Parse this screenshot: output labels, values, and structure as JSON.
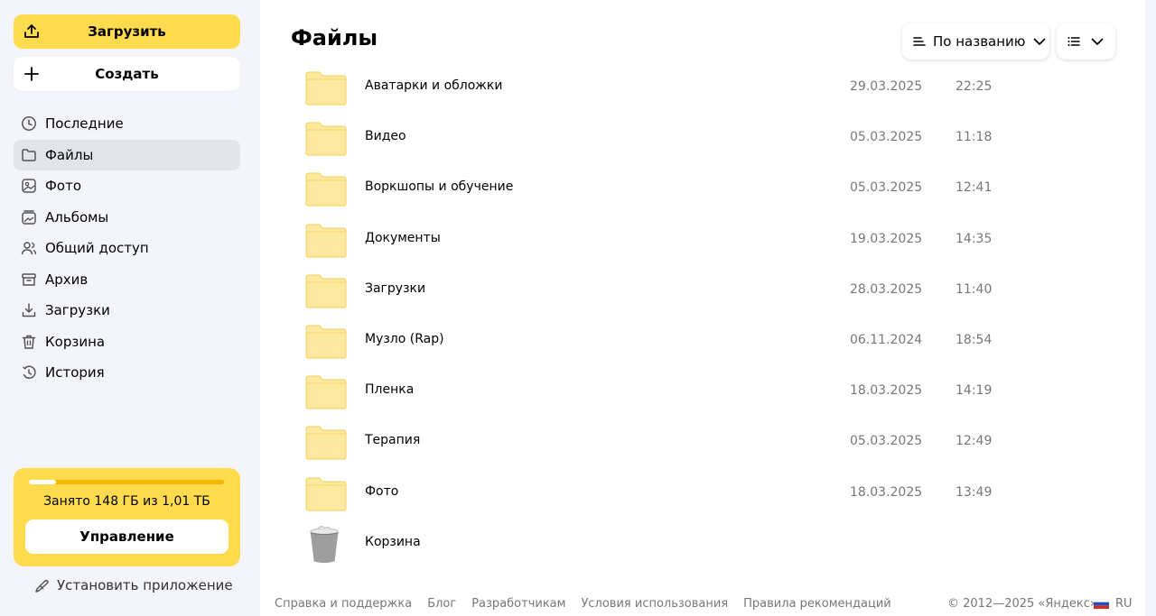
{
  "sidebar": {
    "upload_label": "Загрузить",
    "create_label": "Создать",
    "items": [
      {
        "label": "Последние",
        "icon": "clock-icon"
      },
      {
        "label": "Файлы",
        "icon": "folder-icon",
        "active": true
      },
      {
        "label": "Фото",
        "icon": "photo-icon"
      },
      {
        "label": "Альбомы",
        "icon": "album-icon"
      },
      {
        "label": "Общий доступ",
        "icon": "users-icon"
      },
      {
        "label": "Архив",
        "icon": "archive-icon"
      },
      {
        "label": "Загрузки",
        "icon": "download-icon"
      },
      {
        "label": "Корзина",
        "icon": "trash-icon"
      },
      {
        "label": "История",
        "icon": "history-icon"
      }
    ],
    "storage": {
      "text": "Занято 148 ГБ из 1,01 ТБ",
      "used_fraction": 0.14,
      "manage_label": "Управление"
    },
    "install_label": "Установить приложение"
  },
  "main": {
    "title": "Файлы",
    "sort_label": "По названию",
    "files": [
      {
        "name": "Аватарки и обложки",
        "date": "29.03.2025",
        "time": "22:25",
        "type": "folder"
      },
      {
        "name": "Видео",
        "date": "05.03.2025",
        "time": "11:18",
        "type": "folder"
      },
      {
        "name": "Воркшопы и обучение",
        "date": "05.03.2025",
        "time": "12:41",
        "type": "folder"
      },
      {
        "name": "Документы",
        "date": "19.03.2025",
        "time": "14:35",
        "type": "folder"
      },
      {
        "name": "Загрузки",
        "date": "28.03.2025",
        "time": "11:40",
        "type": "folder"
      },
      {
        "name": "Музло (Rap)",
        "date": "06.11.2024",
        "time": "18:54",
        "type": "folder"
      },
      {
        "name": "Пленка",
        "date": "18.03.2025",
        "time": "14:19",
        "type": "folder"
      },
      {
        "name": "Терапия",
        "date": "05.03.2025",
        "time": "12:49",
        "type": "folder"
      },
      {
        "name": "Фото",
        "date": "18.03.2025",
        "time": "13:49",
        "type": "folder"
      },
      {
        "name": "Корзина",
        "date": "",
        "time": "",
        "type": "trash"
      }
    ]
  },
  "footer": {
    "links": [
      "Справка и поддержка",
      "Блог",
      "Разработчикам",
      "Условия использования",
      "Правила рекомендаций"
    ],
    "copyright": "© 2012—2025 «Яндекс»",
    "lang": "RU"
  },
  "colors": {
    "accent": "#ffdb4d",
    "folder": "#fde9a0",
    "folder_stroke": "#f2cf5a",
    "active_nav": "#e2e4ec"
  }
}
